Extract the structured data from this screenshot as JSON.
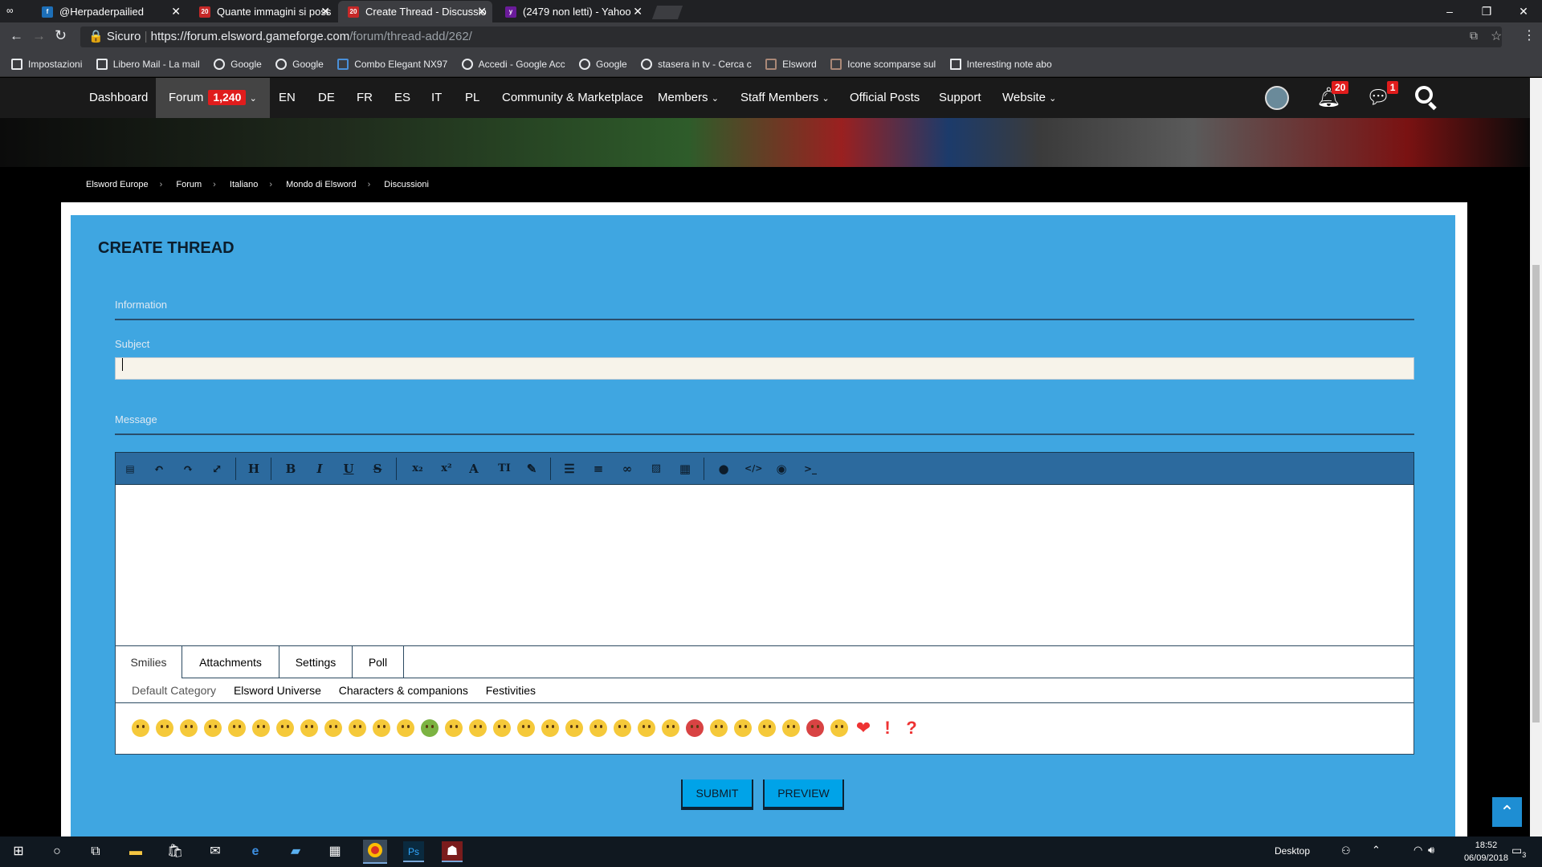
{
  "browser": {
    "tabs": [
      {
        "title": "@Herpaderpailied",
        "color": "#1d6fb8",
        "icon": "tab-favicon"
      },
      {
        "title": "Quante immagini si poss",
        "color": "#c62828",
        "icon": "elsword-favicon"
      },
      {
        "title": "Create Thread - Discussio",
        "color": "#c62828",
        "icon": "elsword-favicon"
      },
      {
        "title": "(2479 non letti) - Yahoo",
        "color": "#6a1b9a",
        "icon": "yahoo-favicon"
      }
    ],
    "secure_label": "Sicuro",
    "url_host": "https://forum.elsword.gameforge.com",
    "url_path": "/forum/thread-add/262/",
    "bookmarks": [
      "Impostazioni",
      "Libero Mail - La mail",
      "Google",
      "Google",
      "Combo Elegant NX97",
      "Accedi - Google Acc",
      "Google",
      "stasera in tv - Cerca c",
      "Elsword",
      "Icone scomparse sul",
      "Interesting note abo"
    ]
  },
  "nav": {
    "items": [
      "Dashboard",
      "Forum",
      "EN",
      "DE",
      "FR",
      "ES",
      "IT",
      "PL",
      "Community & Marketplace",
      "Members",
      "Staff Members",
      "Official Posts",
      "Support",
      "Website"
    ],
    "forum_count": "1,240",
    "notifications_count": "20",
    "messages_count": "1"
  },
  "breadcrumb": [
    "Elsword Europe",
    "Forum",
    "Italiano",
    "Mondo di Elsword",
    "Discussioni"
  ],
  "form": {
    "title": "CREATE THREAD",
    "information_label": "Information",
    "subject_label": "Subject",
    "subject_value": "",
    "message_label": "Message"
  },
  "editor": {
    "toolbar": [
      "source-icon",
      "undo-icon",
      "redo-icon",
      "fullscreen-icon",
      "heading-icon",
      "bold-icon",
      "italic-icon",
      "underline-icon",
      "strike-icon",
      "subscript-icon",
      "superscript-icon",
      "font-size-icon",
      "font-family-icon",
      "color-icon",
      "list-icon",
      "align-icon",
      "link-icon",
      "image-icon",
      "table-icon",
      "quote-icon",
      "code-icon",
      "spoiler-icon",
      "terminal-icon"
    ],
    "toolbar_glyphs": {
      "heading": "H",
      "bold": "B",
      "italic": "I",
      "underline": "U",
      "strike": "S",
      "sub": "x₂",
      "sup": "x²",
      "font": "A",
      "tt": "TI"
    },
    "tabs": [
      "Smilies",
      "Attachments",
      "Settings",
      "Poll"
    ],
    "categories": [
      "Default Category",
      "Elsword Universe",
      "Characters & companions",
      "Festivities"
    ]
  },
  "buttons": {
    "submit": "SUBMIT",
    "preview": "PREVIEW"
  },
  "taskbar": {
    "desktop_label": "Desktop",
    "time": "18:52",
    "date": "06/09/2018",
    "notif_count": "3"
  }
}
